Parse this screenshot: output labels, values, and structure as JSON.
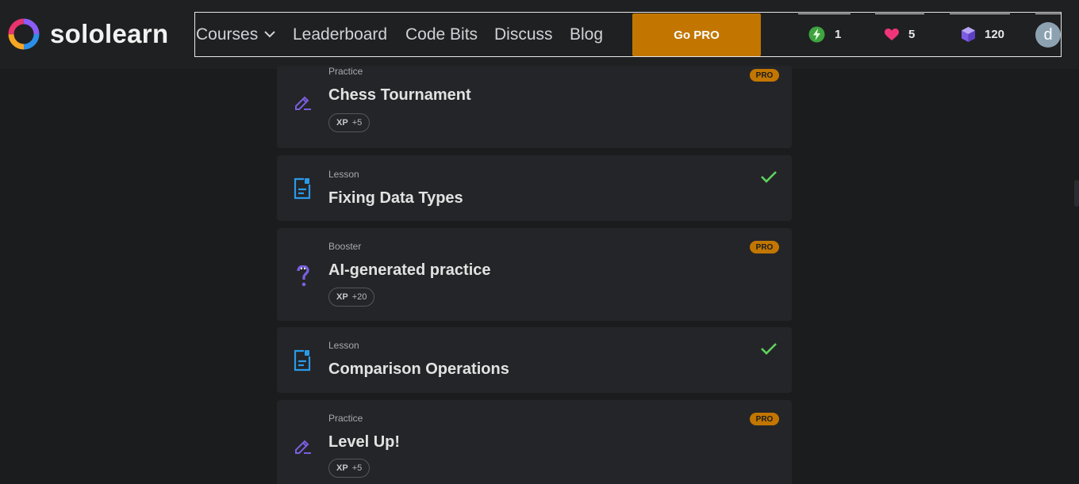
{
  "brand": {
    "name": "sololearn"
  },
  "nav": {
    "courses_label": "Courses",
    "leaderboard_label": "Leaderboard",
    "code_bits_label": "Code Bits",
    "discuss_label": "Discuss",
    "blog_label": "Blog",
    "go_pro_label": "Go PRO"
  },
  "stats": {
    "streak": "1",
    "hearts": "5",
    "gems": "120",
    "avatar_letter": "d"
  },
  "colors": {
    "background": "#1b1c1e",
    "card": "#242528",
    "accent_pro": "#c27600",
    "practice_icon": "#7b5fe0",
    "lesson_icon": "#2a9ae8",
    "check": "#5fd35f",
    "heart": "#f2357a",
    "streak": "#4caf50",
    "gem": "#8b6ee8"
  },
  "items": [
    {
      "type": "Practice",
      "title": "Chess Tournament",
      "icon": "pencil-icon",
      "xp_label": "XP",
      "xp_value": "+5",
      "badge": "PRO"
    },
    {
      "type": "Lesson",
      "title": "Fixing Data Types",
      "icon": "document-icon",
      "completed": true
    },
    {
      "type": "Booster",
      "title": "AI-generated practice",
      "icon": "question-mark-icon",
      "xp_label": "XP",
      "xp_value": "+20",
      "badge": "PRO"
    },
    {
      "type": "Lesson",
      "title": "Comparison Operations",
      "icon": "document-icon",
      "completed": true
    },
    {
      "type": "Practice",
      "title": "Level Up!",
      "icon": "pencil-icon",
      "xp_label": "XP",
      "xp_value": "+5",
      "badge": "PRO"
    }
  ]
}
